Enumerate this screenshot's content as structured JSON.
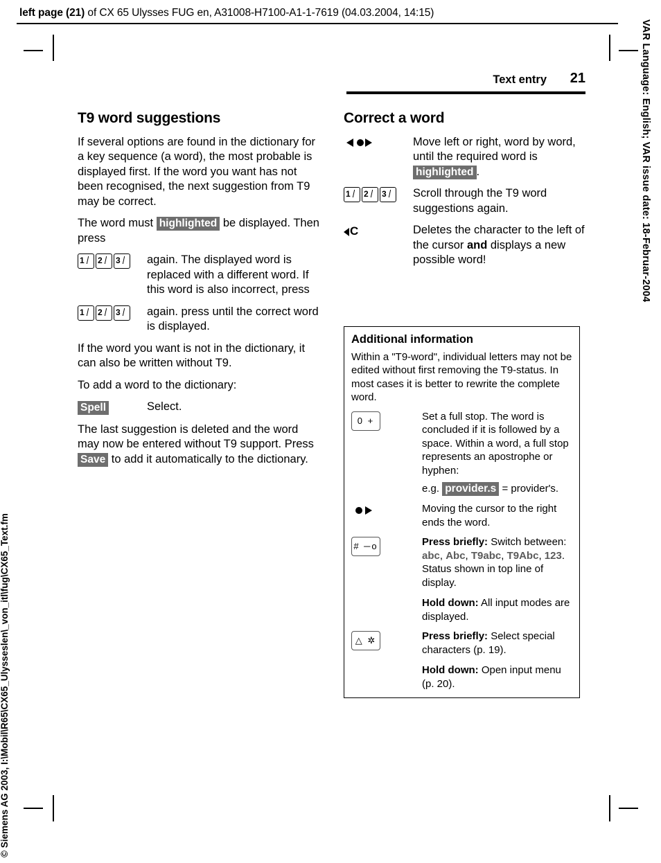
{
  "header": {
    "bold_prefix": "left page (21)",
    "rest": " of CX 65 Ulysses FUG en, A31008-H7100-A1-1-7619 (04.03.2004, 14:15)"
  },
  "side": {
    "right_text": "VAR Language: English; VAR issue date: 18-Februar-2004",
    "left_text_1": "© Siemens AG 2003, I:\\Mobil\\R65\\CX65_Ulysseslen\\_von_itl\\fug\\CX65_Text.fm",
    "left_text_2": "Siemens AG 2003, I:\\Mobil\\R65\\CX65_Ulysseslen\\_von_itl\\fug\\CX65_Text.fm"
  },
  "titlebar": {
    "chapter": "Text entry",
    "page": "21"
  },
  "left_column": {
    "heading": "T9 word suggestions",
    "p1": "If several options are found in the dictionary for a key sequence (a word), the most probable is displayed first. If the word you want has not been recognised, the next suggestion from T9 may be correct.",
    "p2_a": "The word must ",
    "p2_hl": "highlighted",
    "p2_b": " be displayed. Then press",
    "row1_text": "again. The displayed word is replaced with a different word. If this word is also incorrect, press",
    "row2_text": "again. press until the correct word is displayed.",
    "p3": "If the word you want is not in the dictionary, it can also be written without T9.",
    "p4": "To add a word to the dictionary:",
    "spell_label": "Spell",
    "spell_text": "Select.",
    "p5_a": "The last suggestion is deleted and the word may now be entered without T9 support. Press ",
    "p5_save": "Save",
    "p5_b": " to add it automatically to the dictionary."
  },
  "right_column": {
    "heading": "Correct a word",
    "row1_a": "Move left or right, word by word, until the required word is ",
    "row1_hl": "highlighted",
    "row1_b": ".",
    "row2": "Scroll through the T9 word suggestions again.",
    "row3_a": "Deletes the character to the left of the cursor ",
    "row3_bold": "and",
    "row3_b": " displays a new possible word!"
  },
  "infobox": {
    "title": "Additional information",
    "intro": "Within a \"T9-word\", individual letters may not be edited without first removing the T9-status. In most cases it is better to rewrite the complete word.",
    "row1": {
      "text": "Set a full stop. The word is concluded if it is followed by a space. Within a word, a full stop represents an apostrophe or hyphen:",
      "example_prefix": "e.g. ",
      "example_hl": "provider.s",
      "example_suffix": " = provider's.",
      "key_glyph": "0 +"
    },
    "row2": {
      "text": "Moving the cursor to the right ends the word."
    },
    "row3": {
      "b1": "Press briefly:",
      "t1": " Switch between: ",
      "modes": [
        "abc",
        "Abc",
        "T9abc",
        "T9Abc",
        "123"
      ],
      "t2": ". Status shown in top line of display.",
      "b2": "Hold down:",
      "t3": " All input modes are displayed.",
      "key_glyph": "# ─o"
    },
    "row4": {
      "b1": "Press briefly:",
      "t1": " Select special characters (p. 19).",
      "b2": "Hold down:",
      "t2": " Open input menu (p. 20).",
      "key_glyph": "△ ✲"
    }
  },
  "colors": {
    "highlight_bg": "#6e6e6e",
    "highlight_fg": "#ffffff",
    "rule": "#000000"
  }
}
